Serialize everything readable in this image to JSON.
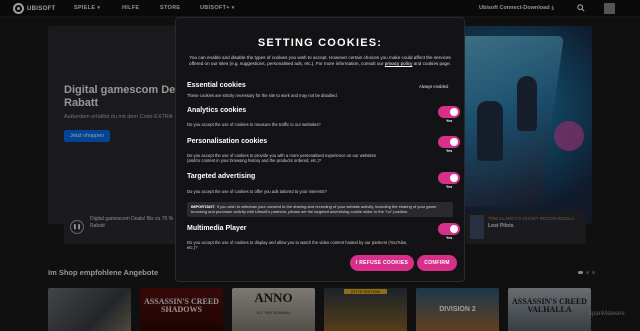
{
  "nav": {
    "logo_text": "UBISOFT",
    "items": [
      "SPIELE",
      "HILFE",
      "STORE",
      "UBISOFT+"
    ],
    "download": "Ubisoft Connect-Download"
  },
  "hero": {
    "title": "Digital gamescom Deals! Rabatt",
    "subtitle": "Außerdem erhältst du mit dem Code EXTRA",
    "button": "Jetzt shoppen"
  },
  "banner_left": {
    "text": "Digital gamescom Deals! Bis zu 75 % Rabatt"
  },
  "banner_right": {
    "label": "TOM CLANCY'S GHOST RECON WILDLA...",
    "title": "Lost Pilots"
  },
  "shop": {
    "title": "Im Shop empfohlene Angebote",
    "cards": [
      {
        "title": ""
      },
      {
        "title": "ASSASSIN'S CREED SHADOWS"
      },
      {
        "title": "ANNO",
        "sub": "117: PAX ROMANA"
      },
      {
        "title": "",
        "sub": "ELITE EDITION"
      },
      {
        "title": "DIVISION 2"
      },
      {
        "title": "ASSASSIN'S CREED VALHALLA"
      }
    ]
  },
  "watermark": "SpanMalware",
  "cookie": {
    "title": "SETTING COOKIES:",
    "intro_pre": "You can enable and disable the types of cookies you wish to accept. However certain choices you make could affect the services offered on our sites (e.g. suggestions, personalised ads, etc.). For more information, consult our ",
    "intro_link": "privacy policy",
    "intro_post": " and cookies page.",
    "sections": [
      {
        "title": "Essential cookies",
        "desc": "These cookies are strictly necessary for the site to work and may not be disabled.",
        "state": "Always enabled"
      },
      {
        "title": "Analytics cookies",
        "desc": "Do you accept the use of cookies to measure the traffic to our websites?",
        "state": "Yes"
      },
      {
        "title": "Personalisation cookies",
        "desc": "Do you accept the use of cookies to provide you with a more personalised experience on our websites (and/or content in your browsing history and the products ordered, etc.)?",
        "state": "Yes"
      },
      {
        "title": "Targeted advertising",
        "desc": "Do you accept the use of cookies to offer you ads tailored to your interests?",
        "state": "Yes"
      },
      {
        "title": "Multimedia Player",
        "desc": "Do you accept the use of cookies to display and allow you to watch the video content hosted by our partners (YouTube, etc.)?",
        "state": "Yes"
      }
    ],
    "notice_bold": "IMPORTANT",
    "notice_text": ": If you wish to withdraw your consent to the sharing and recording of your website activity, including the sharing of your game browsing and purchase activity with Ubisoft's partners, please set the targeted advertising cookie slider to the \"no\" position.",
    "refuse": "I REFUSE COOKIES",
    "confirm": "CONFIRM"
  },
  "colors": {
    "accent": "#d8308a",
    "blue": "#006ef5"
  }
}
